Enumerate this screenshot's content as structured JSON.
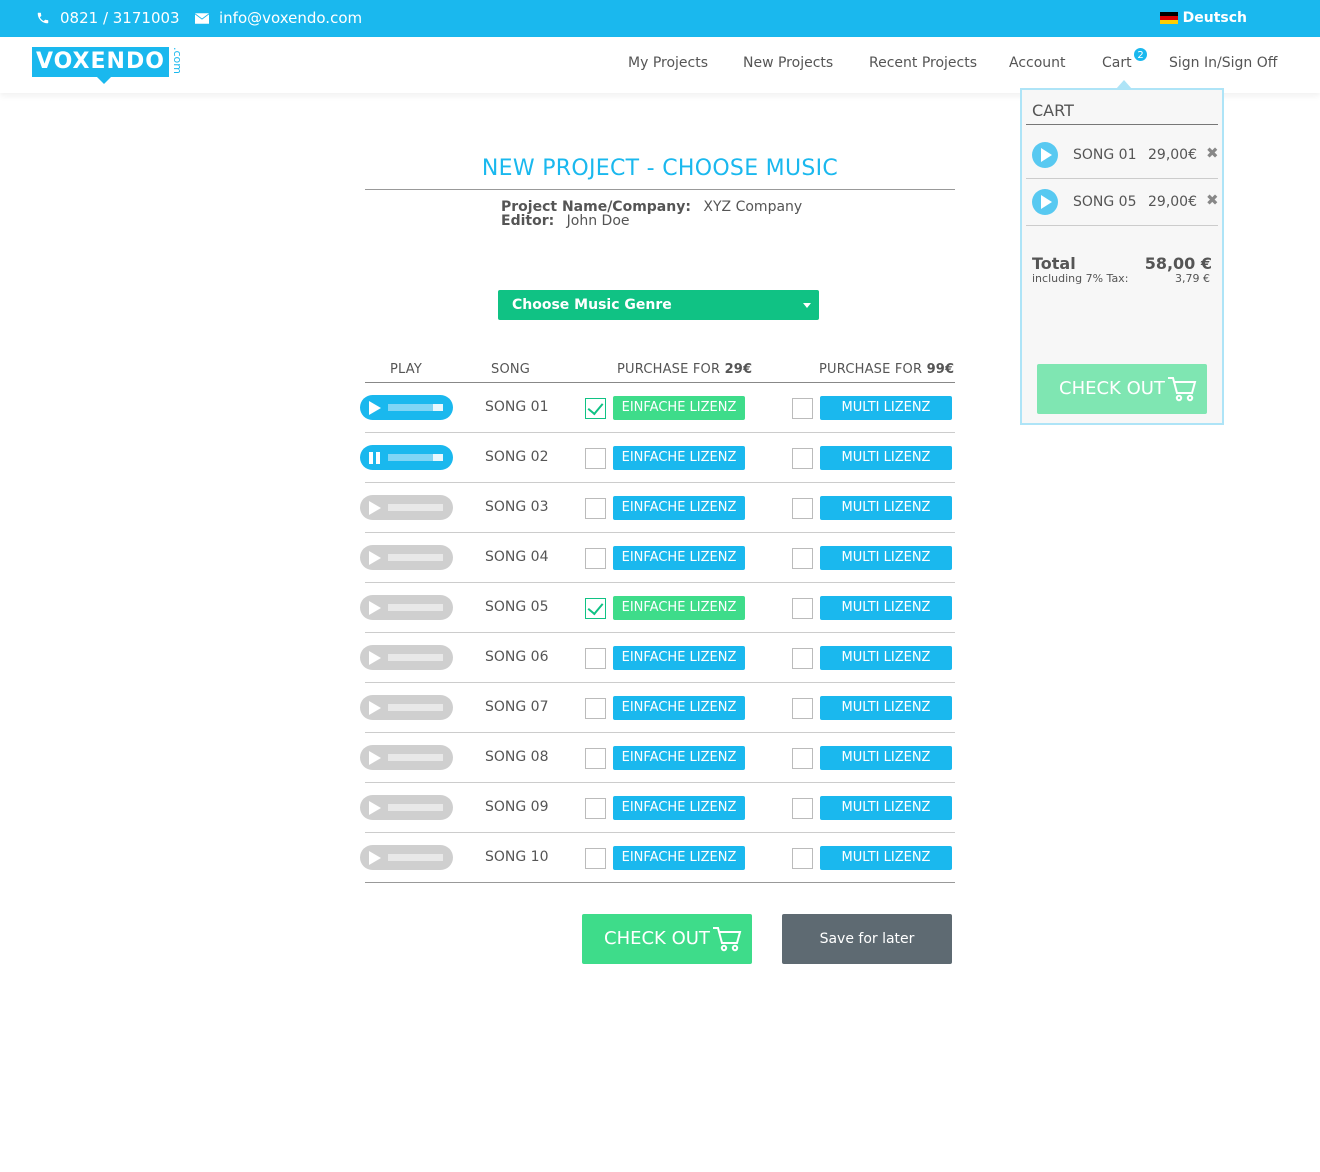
{
  "topbar": {
    "phone": "0821 / 3171003",
    "email": "info@voxendo.com",
    "language": "Deutsch"
  },
  "logo": {
    "main": "VOXENDO",
    "suffix": ".com"
  },
  "nav": {
    "items": [
      "My Projects",
      "New Projects",
      "Recent Projects",
      "Account",
      "Cart",
      "Sign In/Sign Off"
    ],
    "cart_count": "2"
  },
  "page": {
    "title": "NEW PROJECT - CHOOSE MUSIC",
    "project_label": "Project Name/Company:",
    "project_value": "XYZ Company",
    "editor_label": "Editor:",
    "editor_value": "John Doe",
    "genre_label": "Choose Music Genre"
  },
  "table": {
    "headers": {
      "play": "PLAY",
      "song": "SONG",
      "purchase1_prefix": "PURCHASE FOR ",
      "purchase1_price": "29€",
      "purchase2_prefix": "PURCHASE FOR ",
      "purchase2_price": "99€"
    },
    "single_label": "EINFACHE LIZENZ",
    "multi_label": "MULTI LIZENZ",
    "rows": [
      {
        "song": "SONG 01",
        "player": "active",
        "single": true,
        "multi": false
      },
      {
        "song": "SONG 02",
        "player": "playing",
        "single": false,
        "multi": false
      },
      {
        "song": "SONG 03",
        "player": "idle",
        "single": false,
        "multi": false
      },
      {
        "song": "SONG 04",
        "player": "idle",
        "single": false,
        "multi": false
      },
      {
        "song": "SONG 05",
        "player": "idle",
        "single": true,
        "multi": false
      },
      {
        "song": "SONG 06",
        "player": "idle",
        "single": false,
        "multi": false
      },
      {
        "song": "SONG 07",
        "player": "idle",
        "single": false,
        "multi": false
      },
      {
        "song": "SONG 08",
        "player": "idle",
        "single": false,
        "multi": false
      },
      {
        "song": "SONG 09",
        "player": "idle",
        "single": false,
        "multi": false
      },
      {
        "song": "SONG 10",
        "player": "idle",
        "single": false,
        "multi": false
      }
    ]
  },
  "actions": {
    "checkout": "CHECK OUT",
    "save": "Save for later"
  },
  "cart": {
    "title": "CART",
    "items": [
      {
        "name": "SONG 01",
        "price": "29,00€"
      },
      {
        "name": "SONG 05",
        "price": "29,00€"
      }
    ],
    "remove_glyph": "✖",
    "total_label": "Total",
    "total_value": "58,00 €",
    "tax_label": "including 7% Tax:",
    "tax_value": "3,79 €",
    "checkout": "CHECK OUT"
  },
  "colors": {
    "accent": "#1ab8ee",
    "green": "#10c284",
    "green_light": "#3edc8a",
    "dark_button": "#5e6a72"
  },
  "icons": [
    "phone-icon",
    "mail-icon",
    "flag-de-icon",
    "play-icon",
    "pause-icon",
    "cart-icon",
    "remove-icon",
    "chevron-down-icon"
  ]
}
